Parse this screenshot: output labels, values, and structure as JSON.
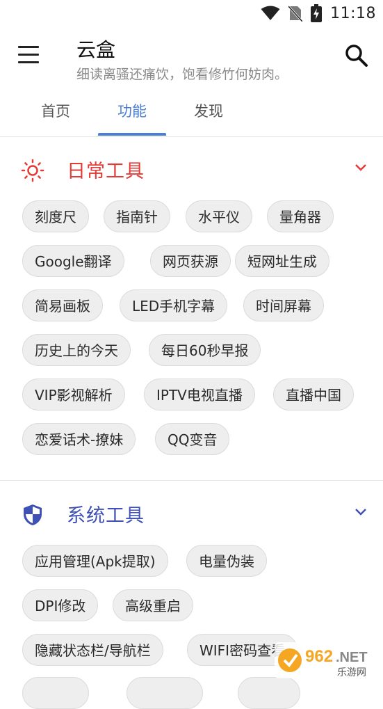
{
  "status_bar": {
    "time": "11:18",
    "icons": [
      "wifi-icon",
      "no-sim-icon",
      "battery-charging-icon"
    ]
  },
  "app_bar": {
    "title": "云盒",
    "subtitle": "细读离骚还痛饮，饱看修竹何妨肉。",
    "menu_icon": "menu-icon",
    "search_icon": "search-icon"
  },
  "tabs": [
    {
      "label": "首页"
    },
    {
      "label": "功能",
      "active": true
    },
    {
      "label": "发现"
    }
  ],
  "sections": [
    {
      "title": "日常工具",
      "icon": "sun-icon",
      "color": "#e53935",
      "expanded": true,
      "chips": [
        "刻度尺",
        "指南针",
        "水平仪",
        "量角器",
        "Google翻译",
        "网页获源",
        "短网址生成",
        "简易画板",
        "LED手机字幕",
        "时间屏幕",
        "历史上的今天",
        "每日60秒早报",
        "VIP影视解析",
        "IPTV电视直播",
        "直播中国",
        "恋爱话术-撩妹",
        "QQ变音"
      ]
    },
    {
      "title": "系统工具",
      "icon": "shield-icon",
      "color": "#3f51b5",
      "expanded": true,
      "chips": [
        "应用管理(Apk提取)",
        "电量伪装",
        "DPI修改",
        "高级重启",
        "隐藏状态栏/导航栏",
        "WIFI密码查看"
      ]
    }
  ],
  "watermark": {
    "brand": "962",
    "suffix": ".NET",
    "text": "乐游网"
  }
}
